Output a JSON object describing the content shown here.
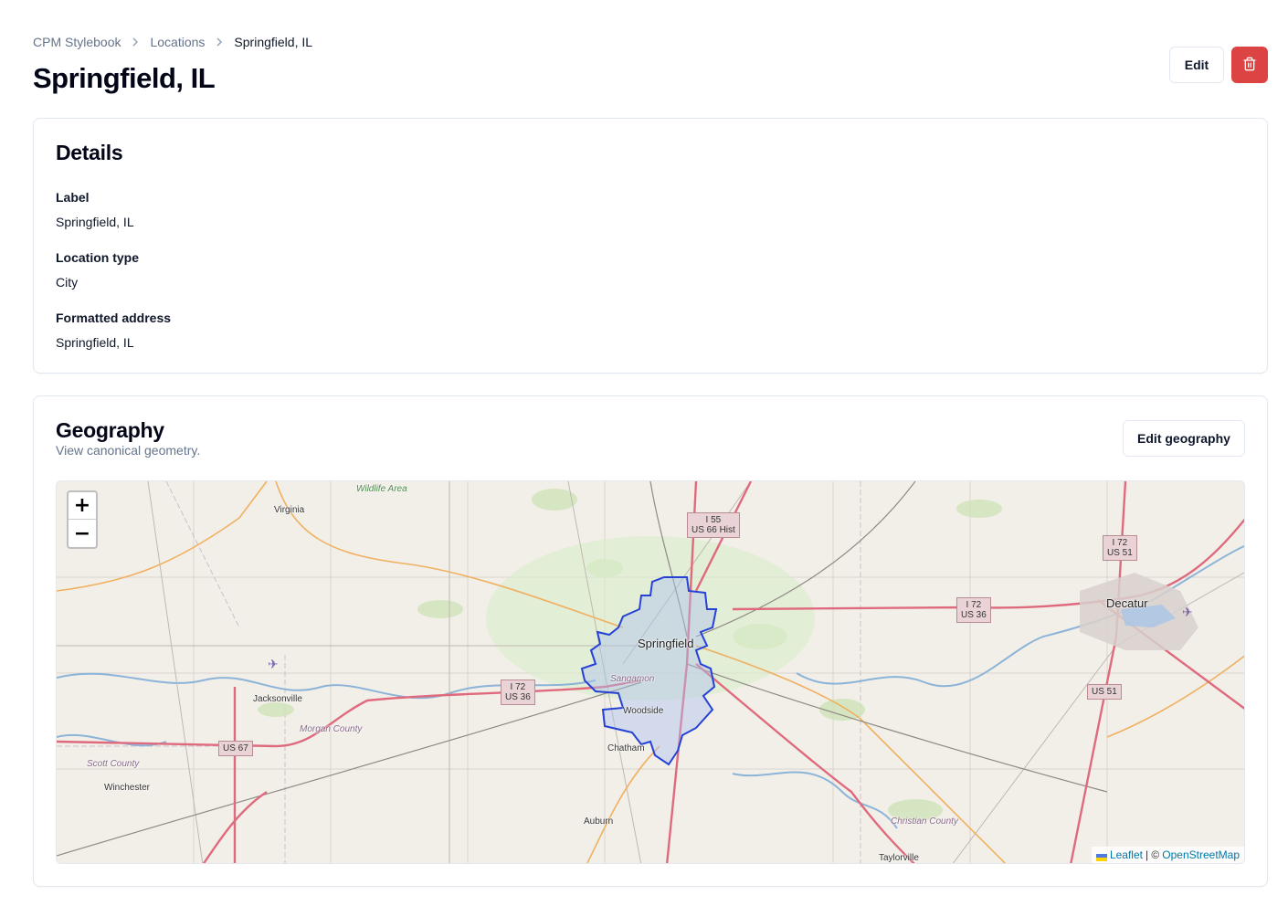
{
  "breadcrumb": {
    "items": [
      "CPM Stylebook",
      "Locations"
    ],
    "current": "Springfield, IL"
  },
  "page": {
    "title": "Springfield, IL",
    "edit_label": "Edit"
  },
  "details": {
    "heading": "Details",
    "fields": [
      {
        "label": "Label",
        "value": "Springfield, IL"
      },
      {
        "label": "Location type",
        "value": "City"
      },
      {
        "label": "Formatted address",
        "value": "Springfield, IL"
      }
    ]
  },
  "geography": {
    "heading": "Geography",
    "subtitle": "View canonical geometry.",
    "edit_label": "Edit geography",
    "map": {
      "zoom_in": "+",
      "zoom_out": "−",
      "attribution": {
        "leaflet": "Leaflet",
        "separator": "| ©",
        "osm": "OpenStreetMap"
      },
      "places": [
        "Virginia",
        "Springfield",
        "Decatur",
        "Jacksonville",
        "Woodside",
        "Chatham",
        "Auburn",
        "Winchester",
        "Taylorville"
      ],
      "regions": [
        "Morgan County",
        "Scott County",
        "Christian County",
        "Wildlife Area",
        "Sangamon"
      ],
      "shields": {
        "i55": [
          "I 55",
          "US 66 Hist"
        ],
        "i72_west": [
          "I 72",
          "US 36"
        ],
        "i72_east": [
          "I 72",
          "US 36"
        ],
        "i72_decatur": [
          "I 72",
          "US 51"
        ],
        "us51": "US 51",
        "us67": "US 67"
      }
    }
  },
  "colors": {
    "delete": "#dc4444",
    "boundary": "#2541d6",
    "motorway": "#e06a7d",
    "primary_road": "#f0b060",
    "river": "#8cb4d8",
    "map_bg": "#f2efe9"
  }
}
